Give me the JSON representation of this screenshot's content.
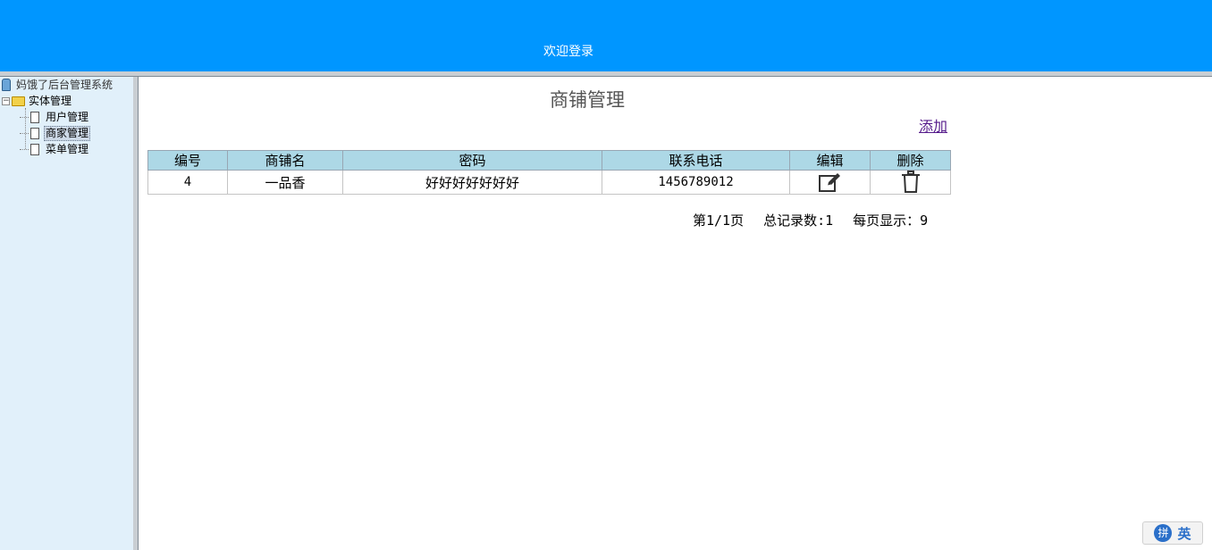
{
  "header": {
    "title": "欢迎登录"
  },
  "tree": {
    "root": "妈饿了后台管理系统",
    "folder": "实体管理",
    "items": [
      {
        "label": "用户管理",
        "selected": false
      },
      {
        "label": "商家管理",
        "selected": true
      },
      {
        "label": "菜单管理",
        "selected": false
      }
    ]
  },
  "main": {
    "title": "商铺管理",
    "add_label": "添加",
    "table": {
      "columns": [
        "编号",
        "商铺名",
        "密码",
        "联系电话",
        "编辑",
        "删除"
      ],
      "rows": [
        {
          "id": "4",
          "name": "一品香",
          "password": "好好好好好好好",
          "phone": "1456789012"
        }
      ]
    },
    "pager": {
      "page": "第1/1页",
      "total": "总记录数:1",
      "per_page": "每页显示：9"
    }
  },
  "ime": {
    "logo": "拼",
    "lang": "英"
  }
}
